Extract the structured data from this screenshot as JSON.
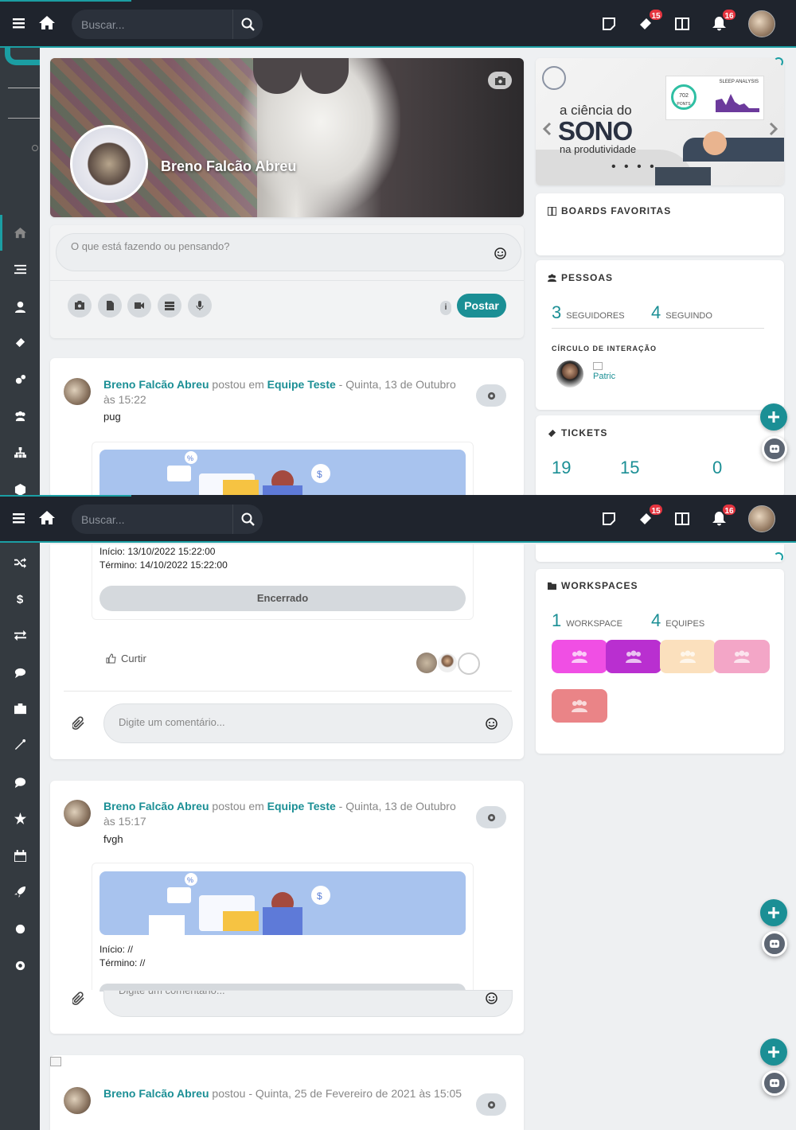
{
  "topbar": {
    "search_placeholder": "Buscar...",
    "badge_tickets": "15",
    "badge_notifications": "16"
  },
  "profile": {
    "name": "Breno Falcão Abreu"
  },
  "composer": {
    "placeholder": "O que está fazendo ou pensando?",
    "post_button": "Postar",
    "info_icon": "i"
  },
  "banner": {
    "line1": "a ciência do",
    "line2": "SONO",
    "line3": "na produtividade",
    "chart_title": "SLEEP ANALYSIS",
    "points_label": "702",
    "points_sub": "PONTS"
  },
  "boards": {
    "title": "BOARDS FAVORITAS"
  },
  "people": {
    "title": "PESSOAS",
    "followers_count": "3",
    "followers_label": "SEGUIDORES",
    "following_count": "4",
    "following_label": "SEGUINDO",
    "circle_title": "CÍRCULO DE INTERAÇÃO",
    "broken_img_alt": "Patric"
  },
  "tickets": {
    "title": "TICKETS",
    "values": [
      "19",
      "15",
      "0"
    ]
  },
  "workspaces": {
    "title": "WORKSPACES",
    "workspace_count": "1",
    "workspace_label": "WORKSPACE",
    "teams_count": "4",
    "teams_label": "EQUIPES",
    "tile_colors": [
      "#f04fe4",
      "#b92fd0",
      "#fbe0bd",
      "#f3a6c7",
      "#ea8487"
    ]
  },
  "post1": {
    "author": "Breno Falcão Abreu",
    "action": " postou em ",
    "team": "Equipe Teste",
    "date": " - Quinta, 13 de Outubro às 15:22",
    "text": "pug",
    "start": "Início: 13/10/2022 15:22:00",
    "end": "Término: 14/10/2022 15:22:00",
    "status": "Encerrado",
    "like": "Curtir",
    "comment_placeholder": "Digite um comentário..."
  },
  "post2": {
    "author": "Breno Falcão Abreu",
    "action": " postou em ",
    "team": "Equipe Teste",
    "date": " - Quinta, 13 de Outubro às 15:17",
    "text": "fvgh",
    "start": "Início: //",
    "end": "Término: //",
    "comment_placeholder": "Digite um comentário..."
  },
  "post3": {
    "author": "Breno Falcão Abreu",
    "action": " postou",
    "date": " - Quinta, 25 de Fevereiro de 2021 às 15:05"
  },
  "colors": {
    "accent": "#1b8f95",
    "topbar": "#1f242d",
    "sidebar": "#343a40",
    "badge": "#e5343f"
  }
}
